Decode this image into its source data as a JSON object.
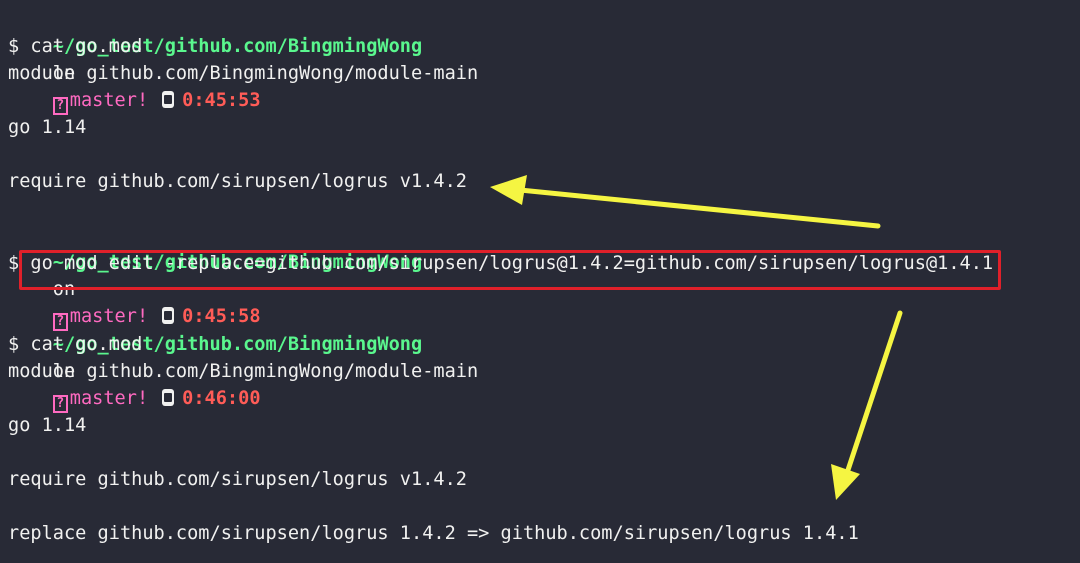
{
  "prompts": [
    {
      "path": "~/go_test/github.com/BingmingWong",
      "on": "on",
      "branch_icon": "?",
      "branch": "master!",
      "time": "0:45:53"
    },
    {
      "path": "~/go_test/github.com/BingmingWong",
      "on": "on",
      "branch_icon": "?",
      "branch": "master!",
      "time": "0:45:58"
    },
    {
      "path": "~/go_test/github.com/BingmingWong",
      "on": "on",
      "branch_icon": "?",
      "branch": "master!",
      "time": "0:46:00"
    }
  ],
  "lines": {
    "cmd1": "$ cat go.mod",
    "module1": "module github.com/BingmingWong/module-main",
    "go1": "go 1.14",
    "require1": "require github.com/sirupsen/logrus v1.4.2",
    "cmd2": "$ go mod edit -replace=github.com/sirupsen/logrus@1.4.2=github.com/sirupsen/logrus@1.4.1",
    "cmd3": "$ cat go.mod",
    "module2": "module github.com/BingmingWong/module-main",
    "go2": "go 1.14",
    "require2": "require github.com/sirupsen/logrus v1.4.2",
    "replace2": "replace github.com/sirupsen/logrus 1.4.2 => github.com/sirupsen/logrus 1.4.1"
  },
  "colors": {
    "background": "#282a36",
    "path": "#5af78e",
    "branch": "#ff6ac1",
    "time": "#ff5c57",
    "highlight_box": "#e0202a",
    "arrow": "#f5f542"
  }
}
